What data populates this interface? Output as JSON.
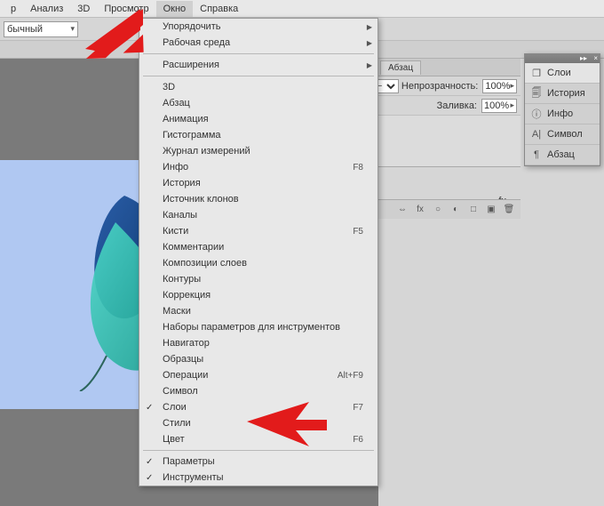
{
  "menubar": {
    "items": [
      {
        "label": "р"
      },
      {
        "label": "Анализ"
      },
      {
        "label": "3D"
      },
      {
        "label": "Просмотр"
      },
      {
        "label": "Окно"
      },
      {
        "label": "Справка"
      }
    ],
    "active_index": 4
  },
  "optbar": {
    "mode_label": "бычный"
  },
  "dropdown": {
    "groups": [
      [
        {
          "label": "Упорядочить",
          "submenu": true
        },
        {
          "label": "Рабочая среда",
          "submenu": true
        }
      ],
      [
        {
          "label": "Расширения",
          "submenu": true
        }
      ],
      [
        {
          "label": "3D"
        },
        {
          "label": "Абзац"
        },
        {
          "label": "Анимация"
        },
        {
          "label": "Гистограмма"
        },
        {
          "label": "Журнал измерений"
        },
        {
          "label": "Инфо",
          "shortcut": "F8"
        },
        {
          "label": "История"
        },
        {
          "label": "Источник клонов"
        },
        {
          "label": "Каналы"
        },
        {
          "label": "Кисти",
          "shortcut": "F5"
        },
        {
          "label": "Комментарии"
        },
        {
          "label": "Композиции слоев"
        },
        {
          "label": "Контуры"
        },
        {
          "label": "Коррекция"
        },
        {
          "label": "Маски"
        },
        {
          "label": "Наборы параметров для инструментов"
        },
        {
          "label": "Навигатор"
        },
        {
          "label": "Образцы"
        },
        {
          "label": "Операции",
          "shortcut": "Alt+F9"
        },
        {
          "label": "Символ"
        },
        {
          "label": "Слои",
          "shortcut": "F7",
          "checked": true
        },
        {
          "label": "Стили"
        },
        {
          "label": "Цвет",
          "shortcut": "F6"
        }
      ],
      [
        {
          "label": "Параметры",
          "checked": true
        },
        {
          "label": "Инструменты",
          "checked": true
        }
      ]
    ]
  },
  "right_panel": {
    "tabs": [
      {
        "label": "Абзац"
      }
    ],
    "opacity_label": "Непрозрачность:",
    "opacity_value": "100%",
    "fill_label": "Заливка:",
    "fill_value": "100%",
    "fx_label": "fx",
    "footer_icons": [
      "fx",
      "○",
      "◐",
      "□",
      "▣",
      "🗑"
    ]
  },
  "float_panel": {
    "items": [
      {
        "icon": "layers-icon",
        "glyph": "❐",
        "label": "Слои"
      },
      {
        "icon": "history-icon",
        "glyph": "🗐",
        "label": "История"
      },
      {
        "icon": "info-icon",
        "glyph": "ⓘ",
        "label": "Инфо"
      },
      {
        "icon": "char-icon",
        "glyph": "A|",
        "label": "Символ"
      },
      {
        "icon": "para-icon",
        "glyph": "¶",
        "label": "Абзац"
      }
    ],
    "active_index": 0
  }
}
